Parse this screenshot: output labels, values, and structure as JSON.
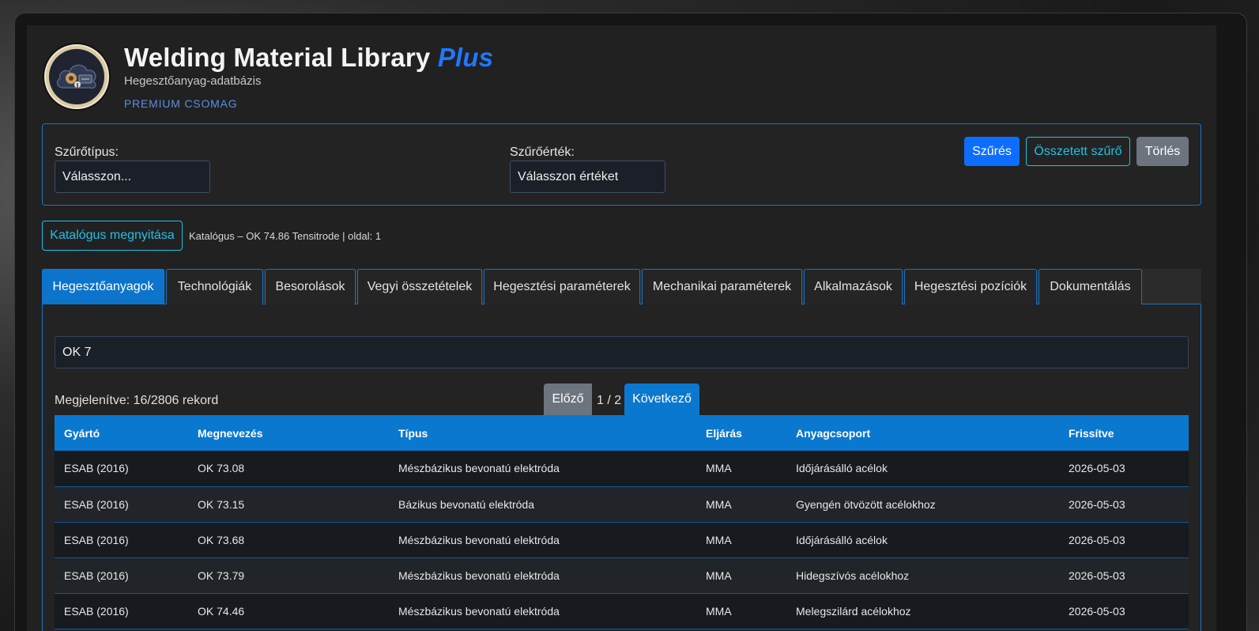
{
  "header": {
    "title": "Welding Material Library",
    "title_accent": "Plus",
    "subtitle": "Hegesztőanyag-adatbázis",
    "package": "PREMIUM CSOMAG"
  },
  "filter": {
    "type_label": "Szűrőtípus:",
    "type_value": "Válasszon...",
    "value_label": "Szűrőérték:",
    "value_value": "Válasszon értéket",
    "filter_btn": "Szűrés",
    "complex_btn": "Összetett szűrő",
    "clear_btn": "Törlés"
  },
  "catalog": {
    "open_btn": "Katalógus megnyitása",
    "info": "Katalógus – OK 74.86 Tensitrode | oldal: 1"
  },
  "tabs": [
    {
      "label": "Hegesztőanyagok",
      "active": true
    },
    {
      "label": "Technológiák"
    },
    {
      "label": "Besorolások"
    },
    {
      "label": "Vegyi összetételek"
    },
    {
      "label": "Hegesztési paraméterek"
    },
    {
      "label": "Mechanikai paraméterek"
    },
    {
      "label": "Alkalmazások"
    },
    {
      "label": "Hegesztési pozíciók"
    },
    {
      "label": "Dokumentálás"
    }
  ],
  "search": {
    "value": "OK 7"
  },
  "pager": {
    "count_text": "Megjelenítve: 16/2806 rekord",
    "prev": "Előző",
    "page": "1 / 2",
    "next": "Következő"
  },
  "table": {
    "headers": [
      "Gyártó",
      "Megnevezés",
      "Típus",
      "Eljárás",
      "Anyagcsoport",
      "Frissítve"
    ],
    "rows": [
      [
        "ESAB (2016)",
        "OK 73.08",
        "Mészbázikus bevonatú elektróda",
        "MMA",
        "Időjárásálló acélok",
        "2026-05-03"
      ],
      [
        "ESAB (2016)",
        "OK 73.15",
        "Bázikus bevonatú elektróda",
        "MMA",
        "Gyengén ötvözött acélokhoz",
        "2026-05-03"
      ],
      [
        "ESAB (2016)",
        "OK 73.68",
        "Mészbázikus bevonatú elektróda",
        "MMA",
        "Időjárásálló acélok",
        "2026-05-03"
      ],
      [
        "ESAB (2016)",
        "OK 73.79",
        "Mészbázikus bevonatú elektróda",
        "MMA",
        "Hidegszívós acélokhoz",
        "2026-05-03"
      ],
      [
        "ESAB (2016)",
        "OK 74.46",
        "Mészbázikus bevonatú elektróda",
        "MMA",
        "Melegszilárd acélokhoz",
        "2026-05-03"
      ]
    ]
  },
  "colors": {
    "accent": "#0d6efd",
    "table_header": "#0a78cf",
    "outline": "#1ec2e8",
    "panel_border": "#1a73c7"
  },
  "icons": {
    "logo": "cloud-database-icon"
  }
}
